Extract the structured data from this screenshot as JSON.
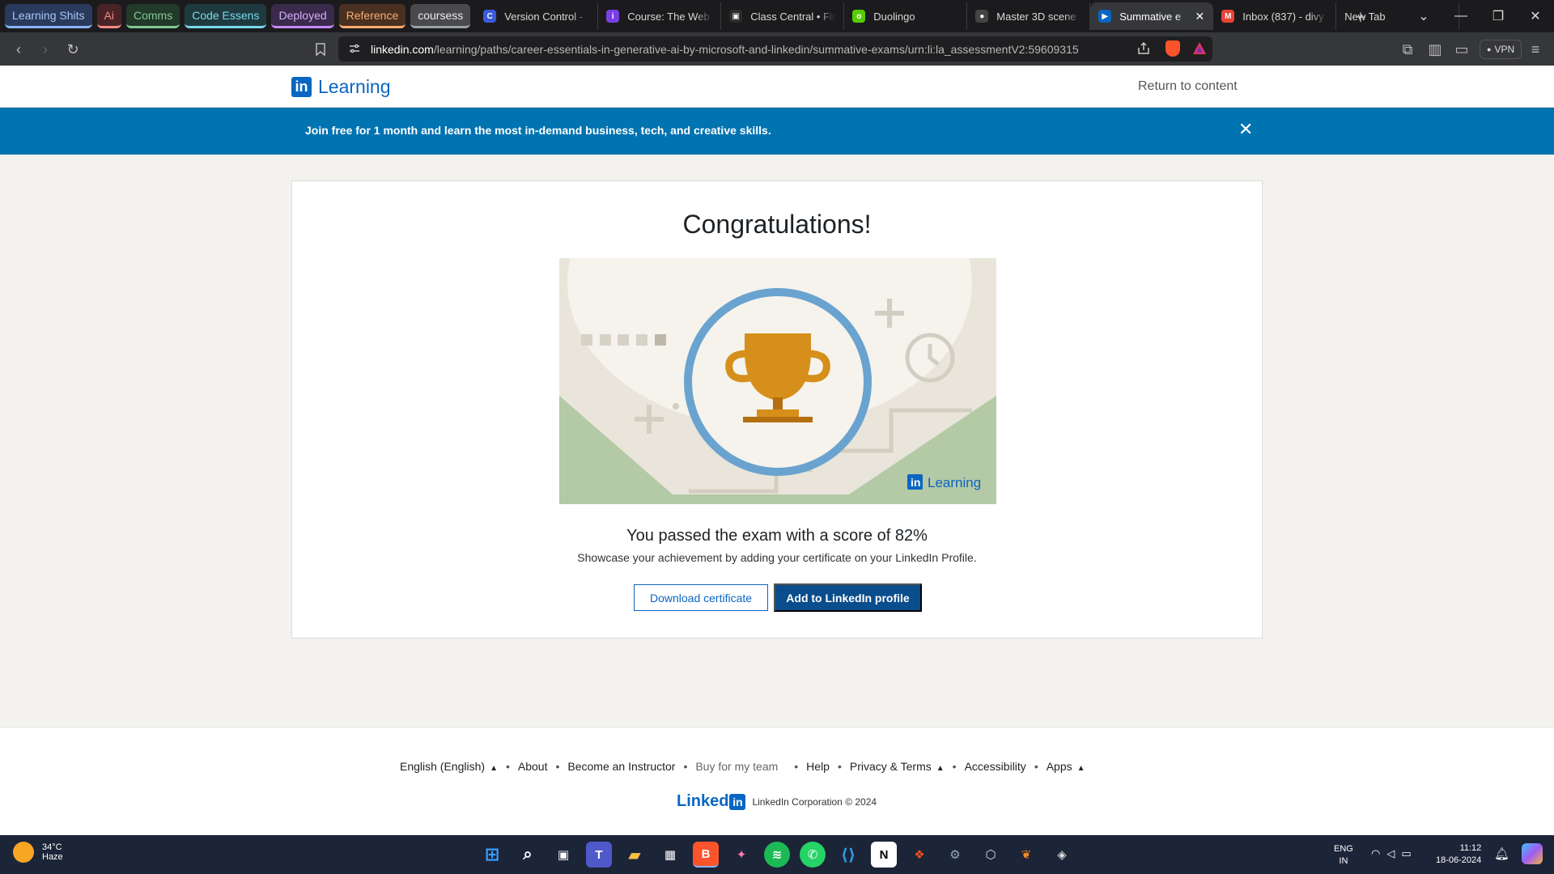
{
  "browser": {
    "tab_groups": [
      {
        "label": "Learning Shits",
        "bg": "#2a3a5c",
        "fg": "#a8c7fa",
        "border": "#8ab4f8"
      },
      {
        "label": "Ai",
        "bg": "#4a2326",
        "fg": "#f28b82",
        "border": "#f28b82"
      },
      {
        "label": "Comms",
        "bg": "#223a2a",
        "fg": "#81c995",
        "border": "#81c995"
      },
      {
        "label": "Code Essens",
        "bg": "#1f3a3f",
        "fg": "#78d9ec",
        "border": "#78d9ec"
      },
      {
        "label": "Deployed",
        "bg": "#3a2a4c",
        "fg": "#d7aefb",
        "border": "#c58af9"
      },
      {
        "label": "Reference",
        "bg": "#4a3020",
        "fg": "#fcad70",
        "border": "#fcad70"
      },
      {
        "label": "coursess",
        "bg": "#4a4a4c",
        "fg": "#e8eaed",
        "border": "#9aa0a6"
      }
    ],
    "tabs": [
      {
        "label": "Version Control -",
        "icon": "C",
        "icon_color": "#3b5bdb"
      },
      {
        "label": "Course: The Web",
        "icon": "i",
        "icon_color": "#7b3fe4"
      },
      {
        "label": "Class Central • Fin",
        "icon": "▣",
        "icon_color": "#2b2b2b"
      },
      {
        "label": "Duolingo",
        "icon": "o",
        "icon_color": "#58cc02"
      },
      {
        "label": "Master 3D scene",
        "icon": "●",
        "icon_color": "#444"
      },
      {
        "label": "Summative e",
        "icon": "▶",
        "icon_color": "#0a66c2",
        "active": true
      },
      {
        "label": "Inbox (837) - divy",
        "icon": "M",
        "icon_color": "#ea4335"
      },
      {
        "label": "New Tab",
        "icon": "",
        "icon_color": ""
      }
    ],
    "url_host": "linkedin.com",
    "url_path": "/learning/paths/career-essentials-in-generative-ai-by-microsoft-and-linkedin/summative-exams/urn:li:la_assessmentV2:59609315",
    "vpn_label": "VPN"
  },
  "header": {
    "logo_in": "in",
    "logo_word": "Learning",
    "return_link": "Return to content"
  },
  "banner": {
    "message": "Join free for 1 month and learn the most in-demand business, tech, and creative skills.",
    "close": "✕"
  },
  "result_card": {
    "title": "Congratulations!",
    "score_text": "You passed the exam with a score of 82%",
    "subtext": "Showcase your achievement by adding your certificate on your LinkedIn Profile.",
    "download_button": "Download certificate",
    "add_profile_button": "Add to LinkedIn profile",
    "illustration_brand": "Learning"
  },
  "footer": {
    "language": "English (English)",
    "about": "About",
    "become_instructor": "Become an Instructor",
    "buy_for_team": "Buy for my team",
    "help": "Help",
    "privacy": "Privacy & Terms",
    "accessibility": "Accessibility",
    "apps": "Apps",
    "brand": "Linked",
    "brand_in": "in",
    "copyright": "LinkedIn Corporation © 2024"
  },
  "taskbar": {
    "temperature": "34°C",
    "weather": "Haze",
    "lang_top": "ENG",
    "lang_bottom": "IN",
    "time": "11:12",
    "date": "18-06-2024"
  }
}
